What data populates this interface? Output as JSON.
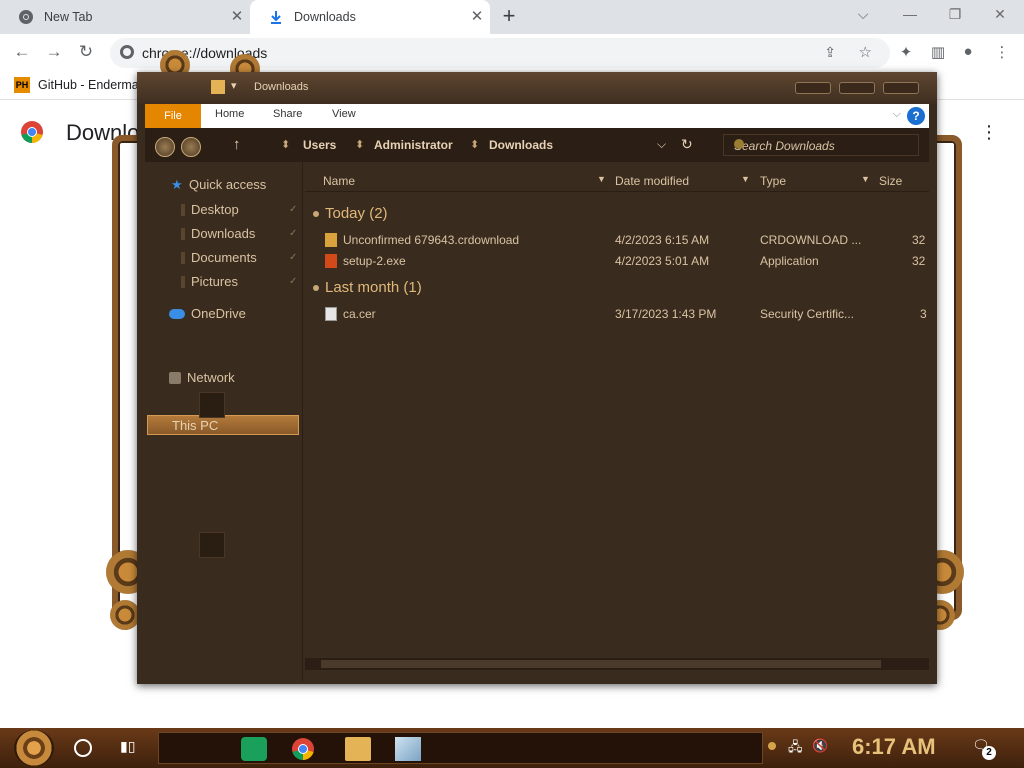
{
  "browser": {
    "tabs": [
      {
        "label": "New Tab",
        "icon": "chrome-icon"
      },
      {
        "label": "Downloads",
        "icon": "download-icon"
      }
    ],
    "url_prefix": "Chrome",
    "url": "chrome://downloads",
    "bookmarks": [
      {
        "label": "GitHub - Enderma",
        "icon": "ph-icon",
        "icon_text": "PH"
      }
    ],
    "page_title": "Downloads"
  },
  "explorer": {
    "title": "Downloads",
    "ribbon": {
      "file": "File",
      "tabs": [
        "Home",
        "Share",
        "View"
      ],
      "help": "?"
    },
    "breadcrumb": [
      "Users",
      "Administrator",
      "Downloads"
    ],
    "search_placeholder": "Search Downloads",
    "nav": {
      "quick_access": "Quick access",
      "quick_items": [
        "Desktop",
        "Downloads",
        "Documents",
        "Pictures"
      ],
      "onedrive": "OneDrive",
      "this_pc": "This PC",
      "network": "Network"
    },
    "columns": [
      "Name",
      "Date modified",
      "Type",
      "Size"
    ],
    "groups": [
      {
        "label": "Today (2)",
        "files": [
          {
            "name": "Unconfirmed 679643.crdownload",
            "date": "4/2/2023 6:15 AM",
            "type": "CRDOWNLOAD ...",
            "size": "32"
          },
          {
            "name": "setup-2.exe",
            "date": "4/2/2023 5:01 AM",
            "type": "Application",
            "size": "32"
          }
        ]
      },
      {
        "label": "Last month (1)",
        "files": [
          {
            "name": "ca.cer",
            "date": "3/17/2023 1:43 PM",
            "type": "Security Certific...",
            "size": "3"
          }
        ]
      }
    ]
  },
  "taskbar": {
    "time": "6:17 AM",
    "notifications": "2"
  },
  "colors": {
    "accent_orange": "#e58600",
    "explorer_bg": "#3a2b1f",
    "text_tan": "#d9c3a2",
    "group_gold": "#e0b87a",
    "clock_gold": "#e8c27a"
  }
}
